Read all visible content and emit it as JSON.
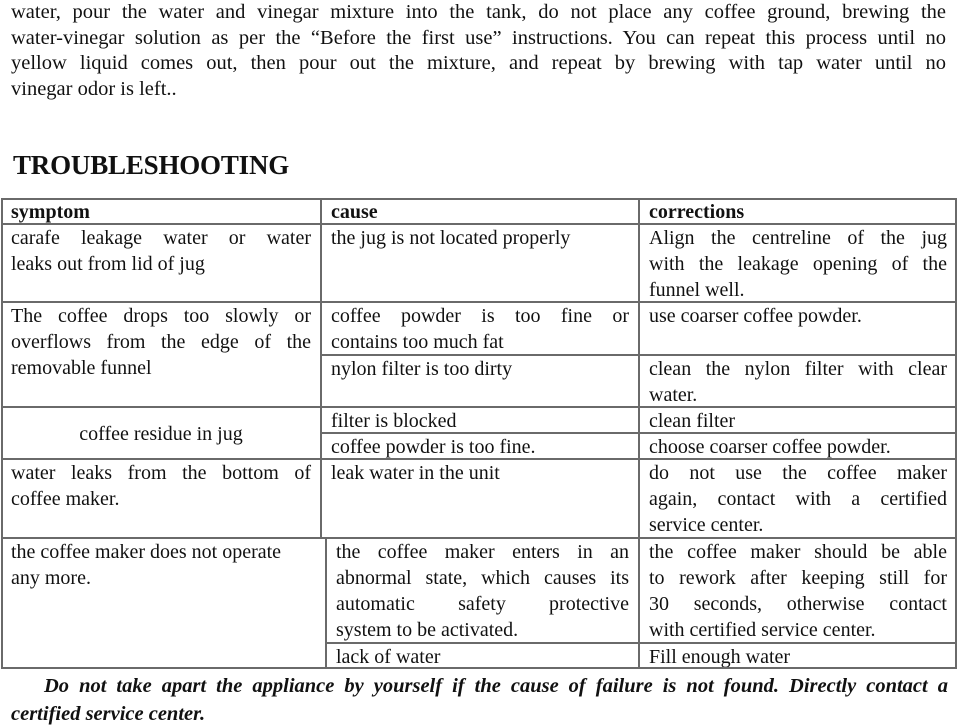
{
  "intro": {
    "lines": [
      "water, pour the water and vinegar mixture into the tank, do not place any coffee ground, brewing the",
      "water-vinegar solution as per the “Before the first use” instructions. You can repeat this process until no",
      "yellow liquid comes out, then pour out the mixture, and repeat by brewing with tap water until no",
      "vinegar odor is left.."
    ]
  },
  "heading": "TROUBLESHOOTING",
  "table": {
    "headers": {
      "symptom": "symptom",
      "cause": "cause",
      "corrections": "corrections"
    },
    "rows": [
      {
        "symptom": [
          "carafe leakage water or water",
          "leaks out from lid of jug"
        ],
        "entries": [
          {
            "cause": [
              "the jug is not located properly"
            ],
            "correction": [
              "Align the centreline of the jug",
              "with the leakage opening of the",
              "funnel well."
            ]
          }
        ]
      },
      {
        "symptom": [
          "The coffee drops too slowly or",
          "overflows from the edge of the",
          "removable funnel"
        ],
        "entries": [
          {
            "cause": [
              "coffee powder is too fine or",
              "contains too much fat"
            ],
            "correction": [
              "use coarser coffee powder."
            ]
          },
          {
            "cause": [
              "nylon filter is too dirty"
            ],
            "correction": [
              "clean the nylon filter with clear",
              "water."
            ]
          }
        ]
      },
      {
        "symptom": [
          "coffee residue in jug"
        ],
        "entries": [
          {
            "cause": [
              "filter is blocked"
            ],
            "correction": [
              "clean filter"
            ]
          },
          {
            "cause": [
              "coffee powder is too fine."
            ],
            "correction": [
              "choose coarser coffee powder."
            ]
          }
        ]
      },
      {
        "symptom": [
          "water leaks from the bottom of",
          "coffee maker."
        ],
        "entries": [
          {
            "cause": [
              "leak water in the unit"
            ],
            "correction": [
              "do not use the coffee maker",
              "again, contact with a certified",
              "service center."
            ]
          }
        ]
      },
      {
        "symptom": [
          "the coffee maker does not operate",
          "any more."
        ],
        "entries": [
          {
            "cause": [
              "the coffee maker enters in an",
              "abnormal state, which causes its",
              "automatic safety protective",
              "system to be activated."
            ],
            "correction": [
              "the coffee maker should be able",
              "to rework after keeping still for",
              "30 seconds, otherwise contact",
              "with certified service center."
            ]
          },
          {
            "cause": [
              "lack of water"
            ],
            "correction": [
              "Fill enough water"
            ]
          }
        ]
      }
    ]
  },
  "footer": {
    "line1": "Do not take apart the appliance by yourself if the cause of failure is not found. Directly contact a",
    "line2": "certified service center."
  }
}
